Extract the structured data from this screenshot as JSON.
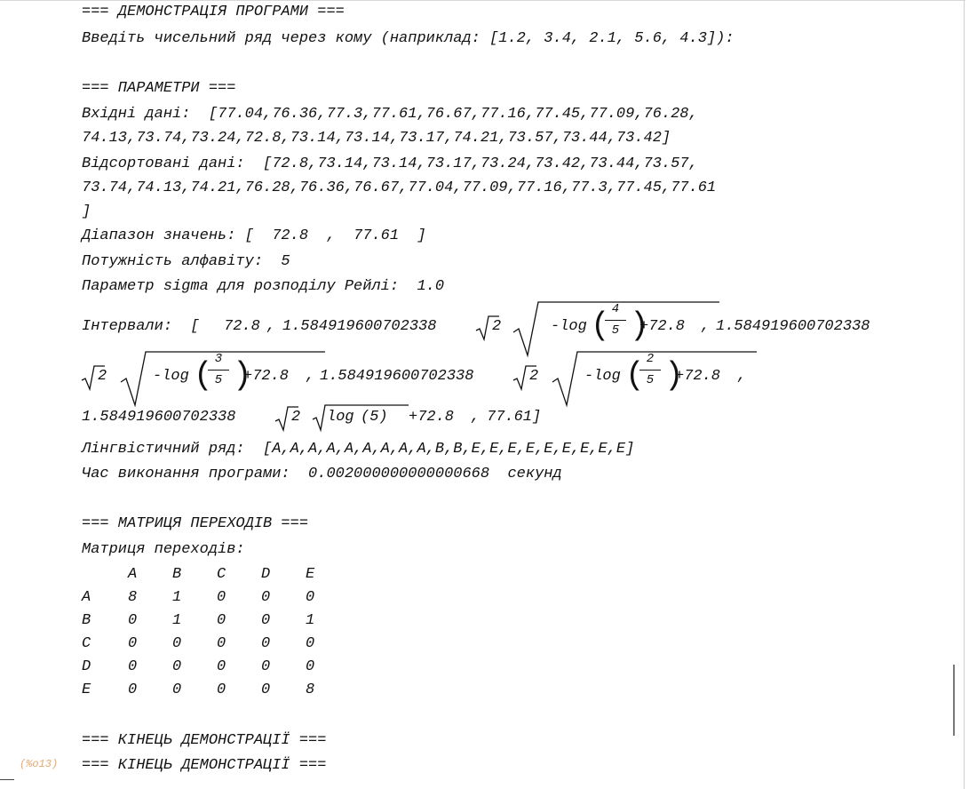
{
  "output_label": "(%o13)",
  "lines": {
    "demo_header": "=== ДЕМОНСТРАЦІЯ ПРОГРАМИ ===",
    "prompt": "Введіть чисельний ряд через кому (наприклад: [1.2, 3.4, 2.1, 5.6, 4.3]):",
    "params_header": "=== ПАРАМЕТРИ ===",
    "input_1": "Вхідні дані:  [77.04,76.36,77.3,77.61,76.67,77.16,77.45,77.09,76.28,",
    "input_2": "74.13,73.74,73.24,72.8,73.14,73.14,73.17,74.21,73.57,73.44,73.42]",
    "sorted_1": "Відсортовані дані:  [72.8,73.14,73.14,73.17,73.24,73.42,73.44,73.57,",
    "sorted_2": "73.74,74.13,74.21,76.28,76.36,76.67,77.04,77.09,77.16,77.3,77.45,77.61",
    "sorted_3": "]",
    "range": "Діапазон значень: [  72.8  ,  77.61  ]",
    "alphabet": "Потужність алфавіту:  5",
    "sigma": "Параметр sigma для розподілу Рейлі:  1.0",
    "linguistic": "Лінгвістичний ряд:  [A,A,A,A,A,A,A,A,A,B,B,E,E,E,E,E,E,E,E,E]",
    "exec_time": "Час виконання програми:  0.002000000000000668  секунд",
    "matrix_header": "=== МАТРИЦЯ ПЕРЕХОДІВ ===",
    "matrix_label": "Матриця переходів:",
    "end_1": "=== КІНЕЦЬ ДЕМОНСТРАЦІЇ ===",
    "end_2": "=== КІНЕЦЬ ДЕМОНСТРАЦІЇ ==="
  },
  "intervals": {
    "label": "Інтервали:  [",
    "first": "72.8",
    "coef": "1.584919600702338",
    "neg_log": "-log",
    "log": "log",
    "plus_const": "+72.8",
    "sqrt2": "2",
    "frac_4_5": {
      "num": "4",
      "den": "5"
    },
    "frac_3_5": {
      "num": "3",
      "den": "5"
    },
    "frac_2_5": {
      "num": "2",
      "den": "5"
    },
    "log_arg": "(5)",
    "last": "77.61]"
  },
  "matrix": {
    "columns": [
      "A",
      "B",
      "C",
      "D",
      "E"
    ],
    "rows": [
      {
        "label": "A",
        "values": [
          "8",
          "1",
          "0",
          "0",
          "0"
        ]
      },
      {
        "label": "B",
        "values": [
          "0",
          "1",
          "0",
          "0",
          "1"
        ]
      },
      {
        "label": "C",
        "values": [
          "0",
          "0",
          "0",
          "0",
          "0"
        ]
      },
      {
        "label": "D",
        "values": [
          "0",
          "0",
          "0",
          "0",
          "0"
        ]
      },
      {
        "label": "E",
        "values": [
          "0",
          "0",
          "0",
          "0",
          "8"
        ]
      }
    ]
  }
}
